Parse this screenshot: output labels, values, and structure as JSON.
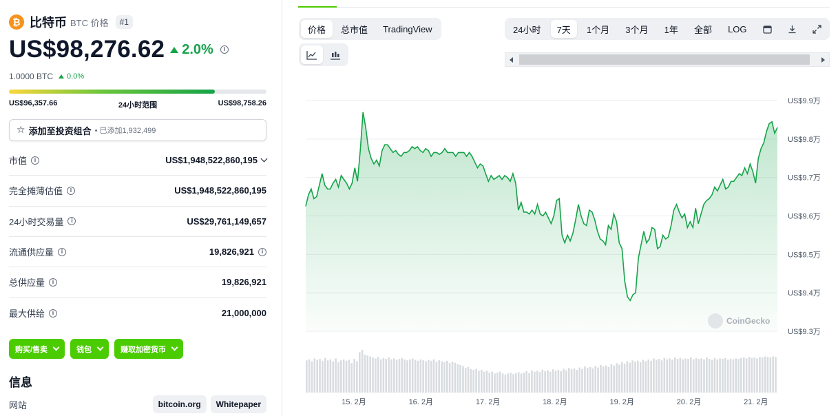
{
  "coin": {
    "logo_glyph": "₿",
    "name": "比特币",
    "symbol_label": "BTC 价格",
    "rank": "#1",
    "price": "US$98,276.62",
    "change_24h": "2.0%",
    "btc_price": "1.0000 BTC",
    "btc_change": "0.0%",
    "accent_color": "#16a34a"
  },
  "range_24h": {
    "low": "US$96,357.66",
    "label": "24小时范围",
    "high": "US$98,758.26",
    "position_fraction": 0.8
  },
  "portfolio": {
    "star_glyph": "☆",
    "label": "添加至投资组合",
    "added": "• 已添加1,932,499"
  },
  "stats": [
    {
      "label": "市值",
      "value": "US$1,948,522,860,195"
    },
    {
      "label": "完全摊薄估值",
      "value": "US$1,948,522,860,195"
    },
    {
      "label": "24小时交易量",
      "value": "US$29,761,149,657"
    },
    {
      "label": "流通供应量",
      "value": "19,826,921"
    },
    {
      "label": "总供应量",
      "value": "19,826,921"
    },
    {
      "label": "最大供给",
      "value": "21,000,000"
    }
  ],
  "actions": [
    "购买/售卖",
    "钱包",
    "赚取加密货币"
  ],
  "info": {
    "title": "信息",
    "website_label": "网站",
    "links": [
      "bitcoin.org",
      "Whitepaper"
    ]
  },
  "chart_tabs": [
    "价格",
    "总市值",
    "TradingView"
  ],
  "range_tabs": [
    "24小时",
    "7天",
    "1个月",
    "3个月",
    "1年",
    "全部",
    "LOG"
  ],
  "active_range": "7天",
  "watermark": "CoinGecko",
  "chart_data": {
    "type": "area",
    "ylabels": [
      "US$9.9万",
      "US$9.8万",
      "US$9.7万",
      "US$9.6万",
      "US$9.5万",
      "US$9.4万",
      "US$9.3万"
    ],
    "ylim": [
      93000,
      99000
    ],
    "xlabels": [
      "15. 2月",
      "16. 2月",
      "17. 2月",
      "18. 2月",
      "19. 2月",
      "20. 2月",
      "21. 2月"
    ],
    "grid": true,
    "color": "#16a34a",
    "values": [
      96250,
      96550,
      96700,
      96450,
      96500,
      96800,
      97100,
      96800,
      96700,
      96700,
      96850,
      96950,
      96750,
      97050,
      96950,
      96850,
      96700,
      96850,
      97250,
      96900,
      97700,
      98700,
      98300,
      97750,
      97500,
      97350,
      97450,
      97300,
      97700,
      97850,
      97850,
      97750,
      97650,
      97700,
      97600,
      97550,
      97650,
      97650,
      97700,
      97800,
      97750,
      97800,
      97700,
      97650,
      97750,
      97700,
      97550,
      97650,
      97650,
      97600,
      97650,
      97750,
      97650,
      97650,
      97650,
      97550,
      97650,
      97650,
      97650,
      97550,
      97650,
      97550,
      97400,
      97250,
      97350,
      97300,
      97100,
      96900,
      97050,
      96950,
      97000,
      97050,
      96950,
      97050,
      97000,
      96900,
      97100,
      96850,
      96150,
      96350,
      96100,
      96100,
      96050,
      96150,
      96050,
      96300,
      96050,
      96000,
      96100,
      95950,
      95800,
      96000,
      96400,
      96450,
      95500,
      95300,
      95500,
      95350,
      95550,
      95900,
      96300,
      96000,
      95800,
      95750,
      96150,
      96100,
      95900,
      95600,
      95400,
      95350,
      95250,
      95750,
      95650,
      96050,
      95850,
      95300,
      95150,
      94300,
      93900,
      93800,
      93950,
      94000,
      94900,
      95250,
      95600,
      95300,
      95400,
      95700,
      95650,
      95150,
      95200,
      95500,
      95400,
      95450,
      95750,
      96150,
      96300,
      96100,
      95950,
      96050,
      95700,
      95850,
      95700,
      96200,
      95800,
      96050,
      96300,
      96400,
      96450,
      96550,
      96750,
      96650,
      96800,
      96950,
      96700,
      96750,
      96900,
      96900,
      97000,
      97100,
      97050,
      97250,
      97100,
      97350,
      97150,
      96850,
      97500,
      97750,
      97900,
      98200,
      98400,
      98450,
      98150,
      98300
    ],
    "volume": [
      68,
      70,
      66,
      72,
      69,
      71,
      67,
      73,
      68,
      70,
      66,
      72,
      64,
      68,
      70,
      67,
      69,
      62,
      71,
      66,
      85,
      90,
      80,
      78,
      76,
      74,
      72,
      75,
      70,
      73,
      71,
      74,
      70,
      72,
      69,
      71,
      73,
      70,
      68,
      70,
      72,
      69,
      67,
      70,
      68,
      66,
      69,
      67,
      70,
      65,
      68,
      66,
      64,
      67,
      62,
      65,
      63,
      60,
      58,
      56,
      52,
      54,
      50,
      48,
      50,
      46,
      48,
      44,
      46,
      42,
      44,
      40,
      42,
      44,
      40,
      38,
      40,
      42,
      39,
      41,
      43,
      40,
      42,
      45,
      41,
      47,
      44,
      46,
      43,
      48,
      45,
      47,
      44,
      49,
      46,
      48,
      45,
      50,
      47,
      52,
      49,
      51,
      48,
      53,
      50,
      55,
      52,
      54,
      51,
      56,
      53,
      58,
      55,
      57,
      54,
      60,
      57,
      62,
      59,
      64,
      61,
      66,
      63,
      68,
      65,
      67,
      64,
      69,
      66,
      70,
      67,
      72,
      69,
      71,
      68,
      73,
      70,
      72,
      69,
      74,
      71,
      73,
      70,
      72,
      71,
      74,
      70,
      73,
      71,
      72,
      70,
      74,
      71,
      69,
      73,
      70,
      72,
      71,
      73,
      69,
      71,
      70,
      72,
      71,
      73,
      74,
      72,
      75,
      73,
      74,
      72,
      75,
      74,
      76,
      75,
      74,
      76,
      75
    ]
  }
}
